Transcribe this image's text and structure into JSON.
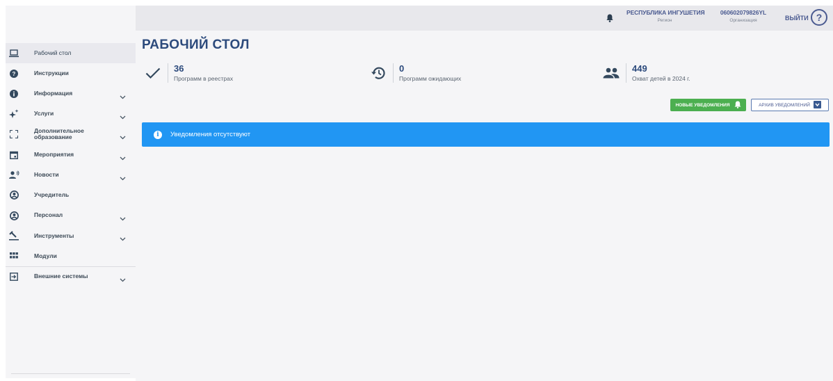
{
  "sidebar": {
    "items": [
      {
        "label": "Рабочий стол",
        "icon": "laptop-icon",
        "active": true,
        "chevron": false
      },
      {
        "label": "Инструкции",
        "icon": "help-circle-icon",
        "chevron": false
      },
      {
        "label": "Информация",
        "icon": "info-circle-icon",
        "chevron": true
      },
      {
        "label": "Услуги",
        "icon": "sparkle-icon",
        "chevron": true
      },
      {
        "label": "Дополнительное образование",
        "icon": "fullscreen-icon",
        "chevron": true
      },
      {
        "label": "Мероприятия",
        "icon": "calendar-icon",
        "chevron": true
      },
      {
        "label": "Новости",
        "icon": "speaker-person-icon",
        "chevron": true
      },
      {
        "label": "Учредитель",
        "icon": "account-circle-icon",
        "chevron": false
      },
      {
        "label": "Персонал",
        "icon": "account-circle-icon",
        "chevron": true
      },
      {
        "label": "Инструменты",
        "icon": "tools-icon",
        "chevron": true
      },
      {
        "label": "Модули",
        "icon": "grid-icon",
        "chevron": false
      },
      {
        "label": "Внешние системы",
        "icon": "login-box-icon",
        "chevron": true
      }
    ]
  },
  "topbar": {
    "region_name": "РЕСПУБЛИКА ИНГУШЕТИЯ",
    "region_caption": "Регион",
    "org_code": "060602079826YL",
    "org_caption": "Организация",
    "logout_label": "ВЫЙТИ",
    "help_label": "?"
  },
  "main": {
    "title": "РАБОЧИЙ СТОЛ",
    "stats": [
      {
        "value": "36",
        "label": "Программ в реестрах",
        "icon": "check-icon"
      },
      {
        "value": "0",
        "label": "Программ ожидающих",
        "icon": "history-icon"
      },
      {
        "value": "449",
        "label": "Охват детей в 2024 г.",
        "icon": "people-icon"
      }
    ],
    "new_notifications_label": "НОВЫЕ УВЕДОМЛЕНИЯ",
    "archive_notifications_label": "АРХИВ УВЕДОМЛЕНИЙ",
    "notice_text": "Уведомления отсутствуют",
    "notice_icon_glyph": "i"
  },
  "colors": {
    "accent": "#2c4a7c",
    "notice_bg": "#2196f3",
    "new_btn_bg": "#4caf50"
  }
}
